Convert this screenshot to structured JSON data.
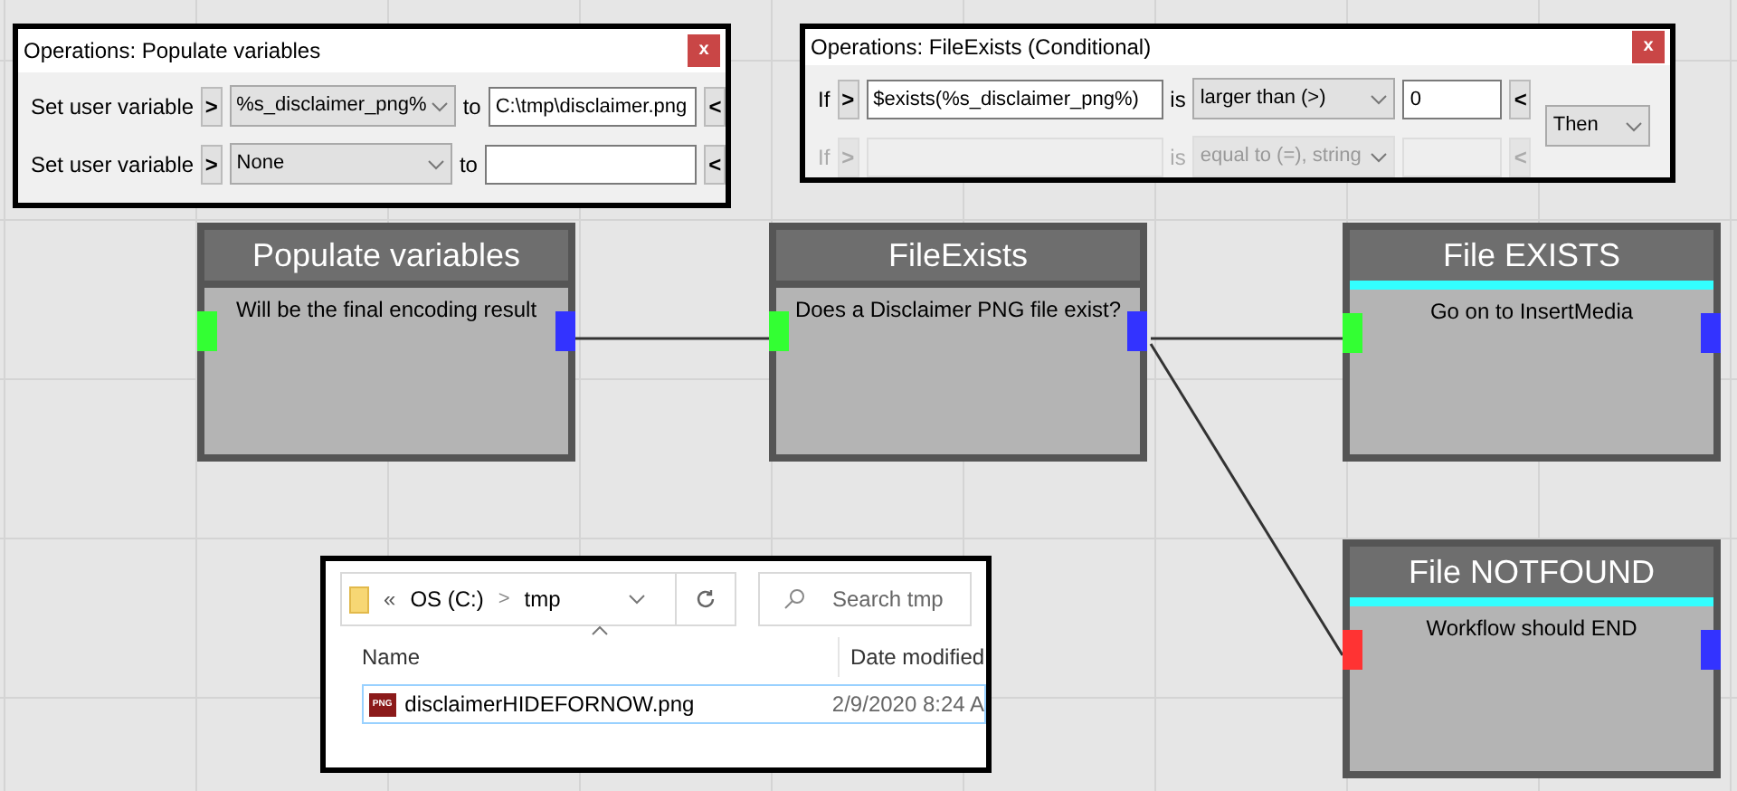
{
  "nodes": [
    {
      "title": "Populate variables",
      "description": "Will be the final encoding result",
      "input_port": {
        "color": "#33ff33"
      },
      "output_port": {
        "color": "#3333ff"
      },
      "accent": false
    },
    {
      "title": "FileExists",
      "description": "Does a Disclaimer PNG file exist?",
      "input_port": {
        "color": "#33ff33"
      },
      "output_port": {
        "color": "#3333ff"
      },
      "accent": false
    },
    {
      "title": "File EXISTS",
      "description": "Go on to InsertMedia",
      "input_port": {
        "color": "#33ff33"
      },
      "output_port": {
        "color": "#3333ff"
      },
      "accent": true
    },
    {
      "title": "File NOTFOUND",
      "description": "Workflow should END",
      "input_port": {
        "color": "#ff3333"
      },
      "output_port": {
        "color": "#3333ff"
      },
      "accent": true
    }
  ],
  "populate_dialog": {
    "title": "Operations: Populate variables",
    "close": "x",
    "rows": [
      {
        "label": "Set user variable",
        "left_arrow": ">",
        "variable": "%s_disclaimer_png%",
        "to": "to",
        "value": "C:\\tmp\\disclaimer.png",
        "right_arrow": "<"
      },
      {
        "label": "Set user variable",
        "left_arrow": ">",
        "variable": "None",
        "to": "to",
        "value": "",
        "right_arrow": "<"
      }
    ]
  },
  "condition_dialog": {
    "title": "Operations: FileExists (Conditional)",
    "close": "x",
    "then": "Then",
    "rows": [
      {
        "label": "If",
        "left_arrow": ">",
        "expression": "$exists(%s_disclaimer_png%)",
        "is": "is",
        "operator": "larger than (>)",
        "value": "0",
        "right_arrow": "<",
        "disabled": false
      },
      {
        "label": "If",
        "left_arrow": ">",
        "expression": "",
        "is": "is",
        "operator": "equal to (=), string",
        "value": "",
        "right_arrow": "<",
        "disabled": true
      }
    ]
  },
  "explorer": {
    "back": "«",
    "path": [
      {
        "label": "OS (C:)"
      },
      {
        "label": "tmp"
      }
    ],
    "separator": ">",
    "search": {
      "placeholder": "Search tmp"
    },
    "columns": [
      "Name",
      "Date modified"
    ],
    "files": [
      {
        "name": "disclaimerHIDEFORNOW.png",
        "date_modified": "2/9/2020 8:24 A",
        "icon_text": "PNG",
        "selected": true
      }
    ]
  }
}
